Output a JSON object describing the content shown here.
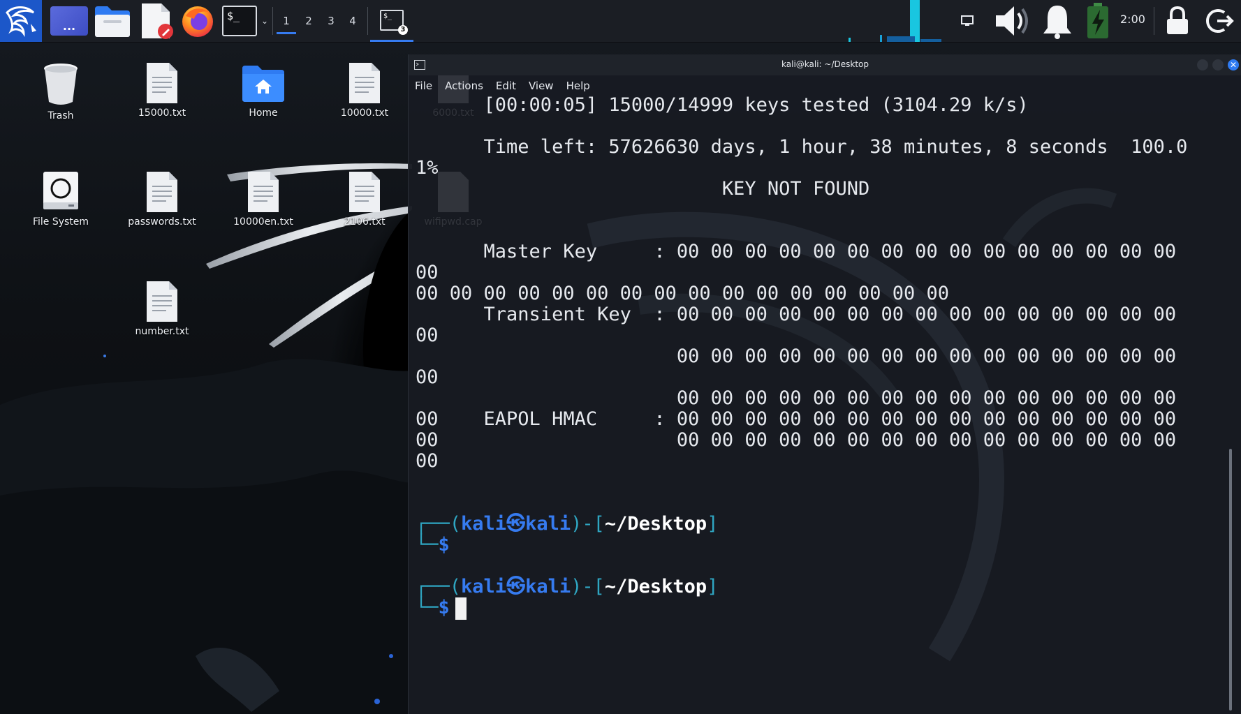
{
  "taskbar": {
    "app_menu_icon": "kali-dragon-icon",
    "launchers": [
      {
        "name": "show-desktop-launcher",
        "icon": "show-desktop-icon",
        "label": "..."
      },
      {
        "name": "file-manager-launcher",
        "icon": "folder-icon"
      },
      {
        "name": "text-editor-launcher",
        "icon": "text-editor-icon"
      },
      {
        "name": "firefox-launcher",
        "icon": "firefox-icon"
      },
      {
        "name": "terminal-launcher",
        "icon": "terminal-icon",
        "label": "$_"
      }
    ],
    "workspaces": [
      "1",
      "2",
      "3",
      "4"
    ],
    "active_workspace": "1",
    "task_button": {
      "icon": "terminal-icon",
      "label": "$_",
      "badge": "3"
    },
    "clock": "2:00",
    "tray_icons": [
      "display-icon",
      "volume-icon",
      "bell-icon",
      "battery-charging-icon",
      "lock-icon",
      "logout-icon"
    ]
  },
  "desktop": {
    "icons": [
      {
        "name": "trash",
        "label": "Trash",
        "icon": "trash-icon"
      },
      {
        "name": "15000-txt",
        "label": "15000.txt",
        "icon": "text-file-icon"
      },
      {
        "name": "home",
        "label": "Home",
        "icon": "home-folder-icon"
      },
      {
        "name": "10000-txt",
        "label": "10000.txt",
        "icon": "text-file-icon"
      },
      {
        "name": "6000-txt",
        "label": "6000.txt",
        "icon": "text-file-icon"
      },
      {
        "name": "file-system",
        "label": "File System",
        "icon": "drive-icon"
      },
      {
        "name": "passwords-txt",
        "label": "passwords.txt",
        "icon": "text-file-icon"
      },
      {
        "name": "10000en-txt",
        "label": "10000en.txt",
        "icon": "text-file-icon"
      },
      {
        "name": "2106-txt",
        "label": "2106.txt",
        "icon": "text-file-icon"
      },
      {
        "name": "wifipwd-cap",
        "label": "wifipwd.cap",
        "icon": "capture-file-icon"
      },
      {
        "name": "number-txt",
        "label": "number.txt",
        "icon": "text-file-icon"
      }
    ]
  },
  "terminal": {
    "title": "kali@kali: ~/Desktop",
    "menu": [
      "File",
      "Actions",
      "Edit",
      "View",
      "Help"
    ],
    "lines": [
      "      [00:00:05] 15000/14999 keys tested (3104.29 k/s)",
      "",
      "      Time left: 57626630 days, 1 hour, 38 minutes, 8 seconds  100.0",
      "1%",
      "                           KEY NOT FOUND",
      "",
      "",
      "      Master Key     : 00 00 00 00 00 00 00 00 00 00 00 00 00 00 00",
      "00",
      "00 00 00 00 00 00 00 00 00 00 00 00 00 00 00 00",
      "      Transient Key  : 00 00 00 00 00 00 00 00 00 00 00 00 00 00 00",
      "00",
      "                       00 00 00 00 00 00 00 00 00 00 00 00 00 00 00",
      "00",
      "                       00 00 00 00 00 00 00 00 00 00 00 00 00 00 00",
      "00    EAPOL HMAC     : 00 00 00 00 00 00 00 00 00 00 00 00 00 00 00",
      "00                     00 00 00 00 00 00 00 00 00 00 00 00 00 00 00",
      "00"
    ],
    "prompt": {
      "open": "┌──(",
      "user": "kali",
      "at": "㉿",
      "host": "kali",
      "mid": ")-[",
      "path": "~/Desktop",
      "close": "]",
      "corner": "└─",
      "dollar": "$"
    }
  },
  "colors": {
    "accent": "#367bf0",
    "prompt_frame": "#2fa6c2",
    "taskbar_bg": "#1b1e24",
    "terminal_bg": "#181b22"
  }
}
